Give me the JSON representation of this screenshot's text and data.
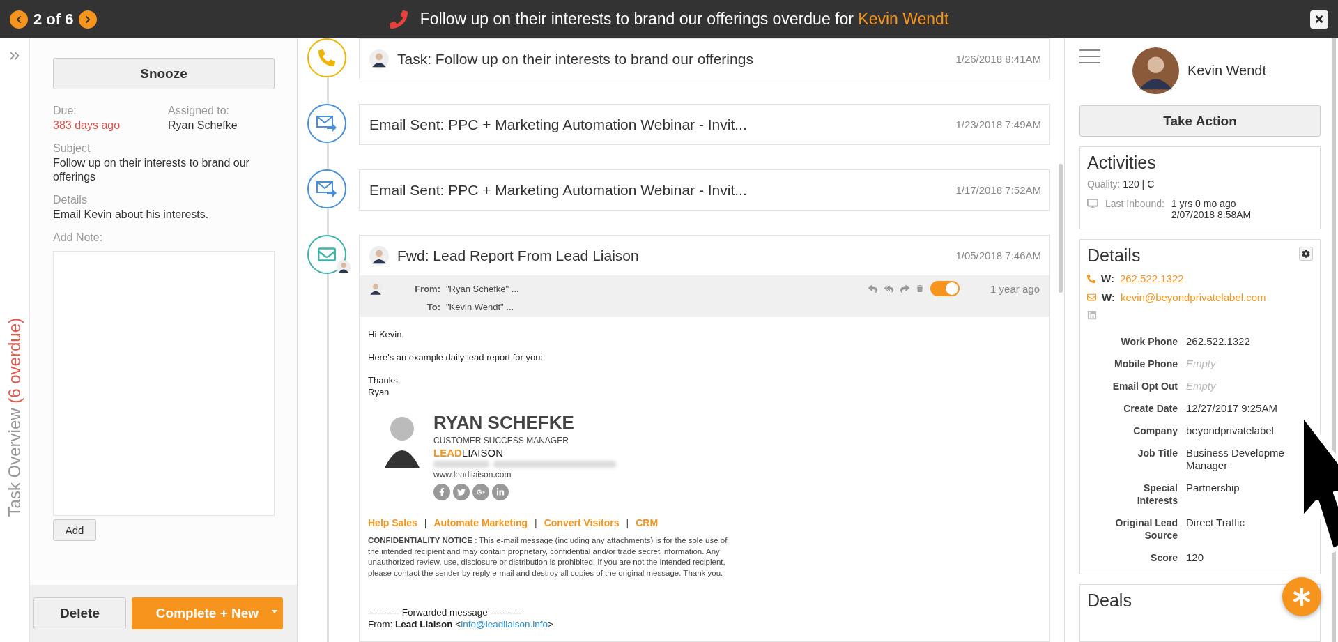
{
  "top_bar": {
    "counter": "2 of 6",
    "title": "Follow up on their interests to brand our offerings overdue for ",
    "contact": "Kevin Wendt"
  },
  "sidebar_tab": {
    "label": "Task Overview ",
    "overdue": "(6 overdue)"
  },
  "task": {
    "snooze": "Snooze",
    "due_label": "Due:",
    "due_value": "383 days ago",
    "assigned_label": "Assigned to:",
    "assigned_value": "Ryan Schefke",
    "subject_label": "Subject",
    "subject": "Follow up on their interests to brand our offerings",
    "details_label": "Details",
    "details": "Email Kevin about his interests.",
    "note_label": "Add Note:",
    "add_button": "Add",
    "delete_button": "Delete",
    "complete_button": "Complete + New"
  },
  "timeline": [
    {
      "kind": "task",
      "title": "Task: Follow up on their interests to brand our offerings",
      "date": "1/26/2018 8:41AM",
      "avatar": true,
      "expanded": false
    },
    {
      "kind": "email_sent",
      "title": "Email Sent: PPC + Marketing Automation Webinar - Invit...",
      "date": "1/23/2018 7:49AM",
      "avatar": false,
      "expanded": false
    },
    {
      "kind": "email_sent",
      "title": "Email Sent: PPC + Marketing Automation Webinar - Invit...",
      "date": "1/17/2018 7:52AM",
      "avatar": false,
      "expanded": false
    },
    {
      "kind": "email_received",
      "title": "Fwd: Lead Report From Lead Liaison",
      "date": "1/05/2018 7:46AM",
      "avatar": true,
      "expanded": true
    }
  ],
  "email": {
    "from_label": "From:",
    "from": "\"Ryan Schefke\" ...",
    "to_label": "To:",
    "to": "\"Kevin Wendt\" ...",
    "ago": "1 year ago",
    "toggle_on": true,
    "greeting": "Hi Kevin,",
    "line": "Here's an example daily lead report for you:",
    "closing": "Thanks,",
    "sender": "Ryan",
    "signature": {
      "name": "RYAN SCHEFKE",
      "role": "CUSTOMER SUCCESS MANAGER",
      "company_a": "LEAD",
      "company_b": "LIAISON",
      "website": "www.leadliaison.com"
    },
    "links": [
      {
        "kind": "link",
        "text": "Help Sales"
      },
      {
        "kind": "separator",
        "text": "|"
      },
      {
        "kind": "link",
        "text": "Automate Marketing"
      },
      {
        "kind": "separator",
        "text": "|"
      },
      {
        "kind": "link",
        "text": "Convert Visitors"
      },
      {
        "kind": "separator",
        "text": "|"
      },
      {
        "kind": "link",
        "text": "CRM"
      }
    ],
    "notice": "**CONFIDENTIALITY NOTICE** : This e-mail message (including any attachments) is for the sole use of the intended recipient and may contain proprietary, confidential and/or trade secret information. Any unauthorized review, use, disclosure or distribution is prohibited.  If you are not the intended recipient, please contact the sender by reply e-mail and destroy all copies of the original message. Thank you.",
    "forwarded": "---------- Forwarded message ----------",
    "fwd_prefix": "From: **Lead Liaison** <",
    "fwd_email": "info@leadliaison.info",
    "fwd_suffix": ">"
  },
  "contact": {
    "name": "Kevin Wendt",
    "take_action": "Take Action",
    "activities": {
      "title": "Activities",
      "quality_label": "Quality:",
      "quality_value": "120 | C",
      "last_inbound_label": "Last Inbound:",
      "last_inbound_ago": "1 yrs 0 mo ago",
      "last_inbound_date": "2/07/2018 8:58AM"
    },
    "details": {
      "title": "Details",
      "phone_label": "W:",
      "phone": "262.522.1322",
      "email_label": "W:",
      "email": "kevin@beyondprivatelabel.com",
      "fields": [
        {
          "label": "Work Phone",
          "value": "262.522.1322",
          "empty": false
        },
        {
          "label": "Mobile Phone",
          "value": "Empty",
          "empty": true
        },
        {
          "label": "Email Opt Out",
          "value": "Empty",
          "empty": true
        },
        {
          "label": "Create Date",
          "value": "12/27/2017 9:25AM",
          "empty": false
        },
        {
          "label": "Company",
          "value": "beyondprivatelabel",
          "empty": false
        },
        {
          "label": "Job Title",
          "value": "Business Developme\nManager",
          "empty": false
        },
        {
          "label": "Special Interests",
          "value": "Partnership",
          "empty": false
        },
        {
          "label": "Original Lead Source",
          "value": "Direct Traffic",
          "empty": false
        },
        {
          "label": "Score",
          "value": "120",
          "empty": false
        }
      ]
    },
    "deals": {
      "title": "Deals"
    }
  }
}
